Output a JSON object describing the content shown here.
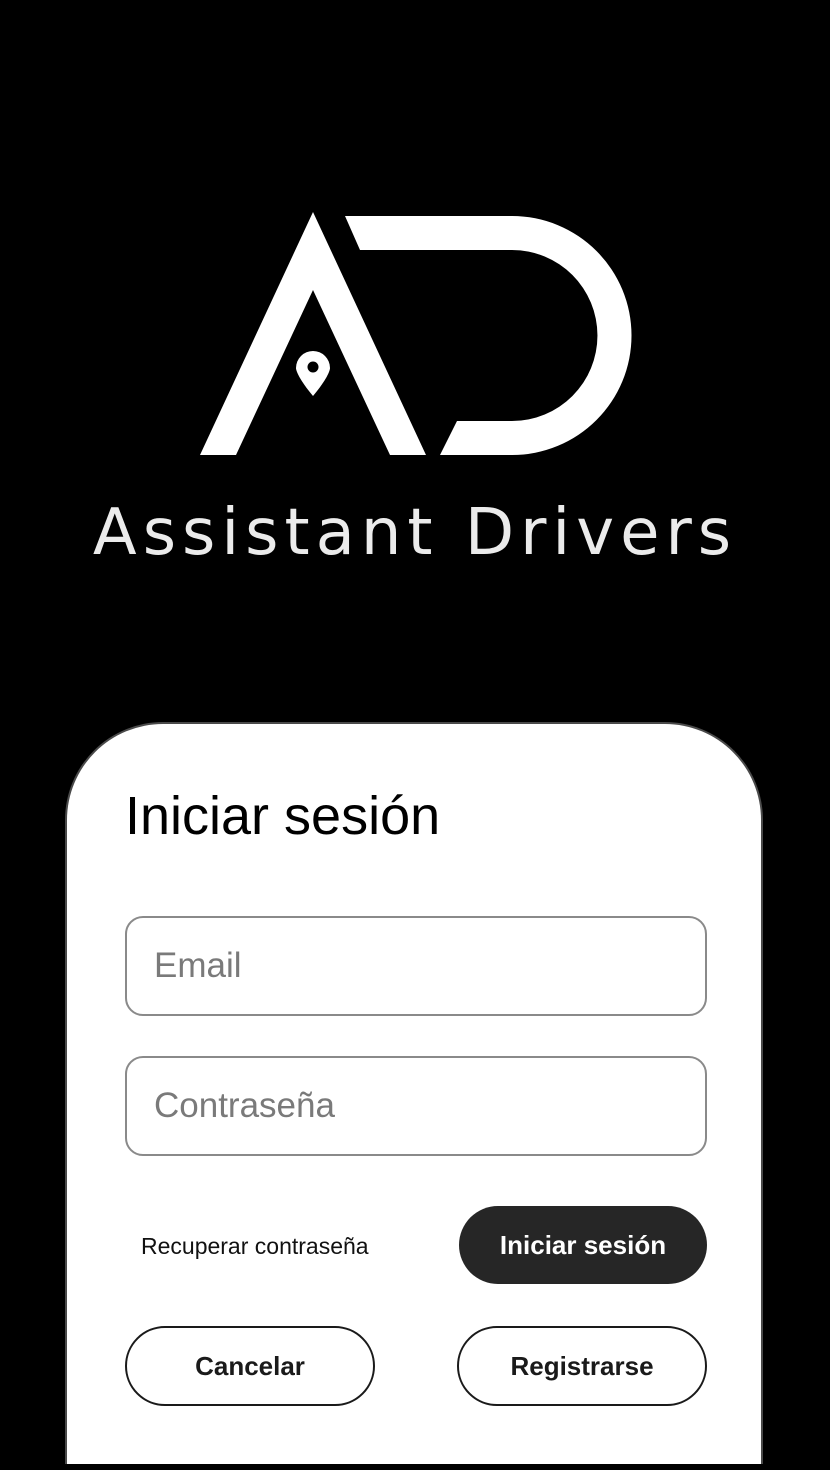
{
  "brand": {
    "name": "Assistant Drivers",
    "logo_icon": "ad-monogram-logo-with-location-pin",
    "logo_color": "#ffffff",
    "background_color": "#000000"
  },
  "login_card": {
    "title": "Iniciar sesión",
    "email_field": {
      "placeholder": "Email",
      "value": ""
    },
    "password_field": {
      "placeholder": "Contraseña",
      "value": ""
    },
    "recover_link": "Recuperar contraseña",
    "login_button": "Iniciar sesión",
    "cancel_button": "Cancelar",
    "register_button": "Registrarse",
    "primary_button_color": "#262626"
  }
}
